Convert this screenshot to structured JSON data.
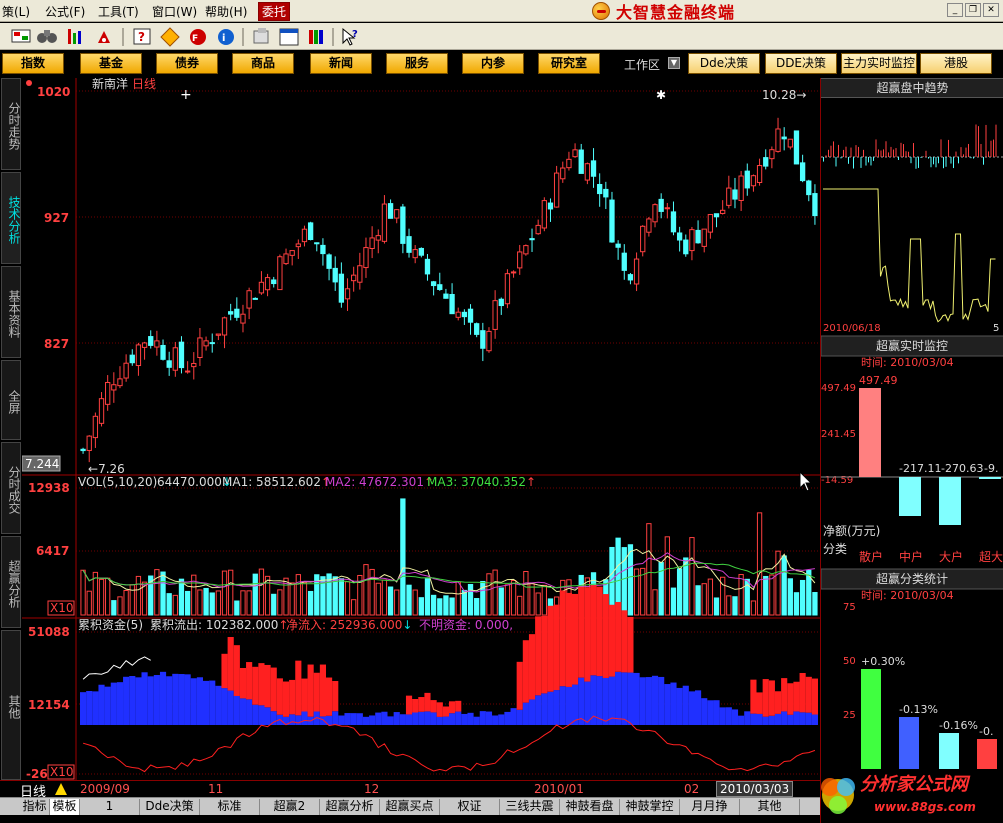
{
  "menubar": {
    "items": [
      "策(L)",
      "公式(F)",
      "工具(T)",
      "窗口(W)",
      "帮助(H)",
      "委托"
    ],
    "brand": "大智慧金融终端"
  },
  "toolbar": {
    "icons": [
      "flag-icon",
      "binoculars-icon",
      "chart-up-icon",
      "alarm-icon",
      "question-icon",
      "diamond-icon",
      "f10-icon",
      "info-icon",
      "copy-icon",
      "window-icon",
      "bookshelf-icon",
      "pointer-help-icon"
    ]
  },
  "funcbar": {
    "buttons": [
      "指数",
      "基金",
      "债券",
      "商品",
      "新闻",
      "服务",
      "内参",
      "研究室"
    ],
    "workarea": "工作区",
    "right_buttons": [
      "Dde决策",
      "DDE决策",
      "主力实时监控",
      "港股"
    ]
  },
  "lefttabs": [
    "分时走势",
    "技术分析",
    "基本资料",
    "全屏",
    "分时成交",
    "超赢分析",
    "其他"
  ],
  "chart": {
    "stock_name": "新南洋",
    "period": "日线",
    "price_axis": [
      "1020",
      "927",
      "827"
    ],
    "current_price_box": "7.244",
    "low_label": "7.26",
    "high_label": "10.28",
    "volume": {
      "header": "VOL(5,10,20)",
      "vol_value": "64470.000",
      "ma1_label": "MA1: 58512.602",
      "ma2_label": "MA2: 47672.301",
      "ma3_label": "MA3: 37040.352",
      "axis": [
        "12938",
        "6417",
        "X10"
      ]
    },
    "capital": {
      "header": "累积资金(5)",
      "outflow": "累积流出: 102382.000",
      "netinflow": "净流入: 252936.000",
      "unknown": "不明资金: 0.000,",
      "axis": [
        "51088",
        "12154",
        "-26",
        "X10"
      ]
    }
  },
  "chart_data": {
    "type": "candlestick",
    "title": "新南洋 日线",
    "ylim": [
      7.1,
      10.5
    ],
    "price_gridlines": [
      10.2,
      9.27,
      8.27
    ],
    "high": 10.28,
    "low": 7.26,
    "date_ticks": [
      "2009/09",
      "11",
      "12",
      "2010/01",
      "02"
    ],
    "current_date": "2010/03/03",
    "volume_ylim": [
      0,
      14000
    ],
    "capital_ylim": [
      -26,
      51088
    ]
  },
  "datebar": {
    "daytag": "日线",
    "dates": [
      "2009/09",
      "11",
      "12",
      "2010/01",
      "02"
    ],
    "current": "2010/03/03"
  },
  "bottombar": {
    "tabs": [
      "指标",
      "模板",
      "1",
      "Dde决策",
      "标准",
      "超赢2",
      "超赢分析",
      "超赢买点",
      "权证",
      "三线共震",
      "神鼓看盘",
      "神鼓掌控",
      "月月挣",
      "其他"
    ]
  },
  "rightpanel": {
    "panel1_title": "超赢盘中趋势",
    "panel1_date": "2010/06/18",
    "panel1_suffix": "5",
    "panel2_title": "超赢实时监控",
    "panel2_time": "时间: 2010/03/04",
    "panel2_axis": [
      "497.49",
      "241.45",
      "-14.59"
    ],
    "panel2_top_value": "497.49",
    "panel2_values": [
      "-217.11",
      "-270.63",
      "-9."
    ],
    "panel2_footer": "净额(万元)",
    "panel2_cats": [
      "散户",
      "中户",
      "大户",
      "超大"
    ],
    "panel3_header_left": "分类",
    "panel3_title": "超赢分类统计",
    "panel3_time": "时间: 2010/03/04",
    "panel3_axis": [
      "75",
      "50",
      "25"
    ],
    "panel3_values": [
      "+0.30%",
      "-0.13%",
      "-0.16%",
      "-0."
    ]
  },
  "watermark": {
    "text": "分析家公式网",
    "url": "www.88gs.com"
  }
}
